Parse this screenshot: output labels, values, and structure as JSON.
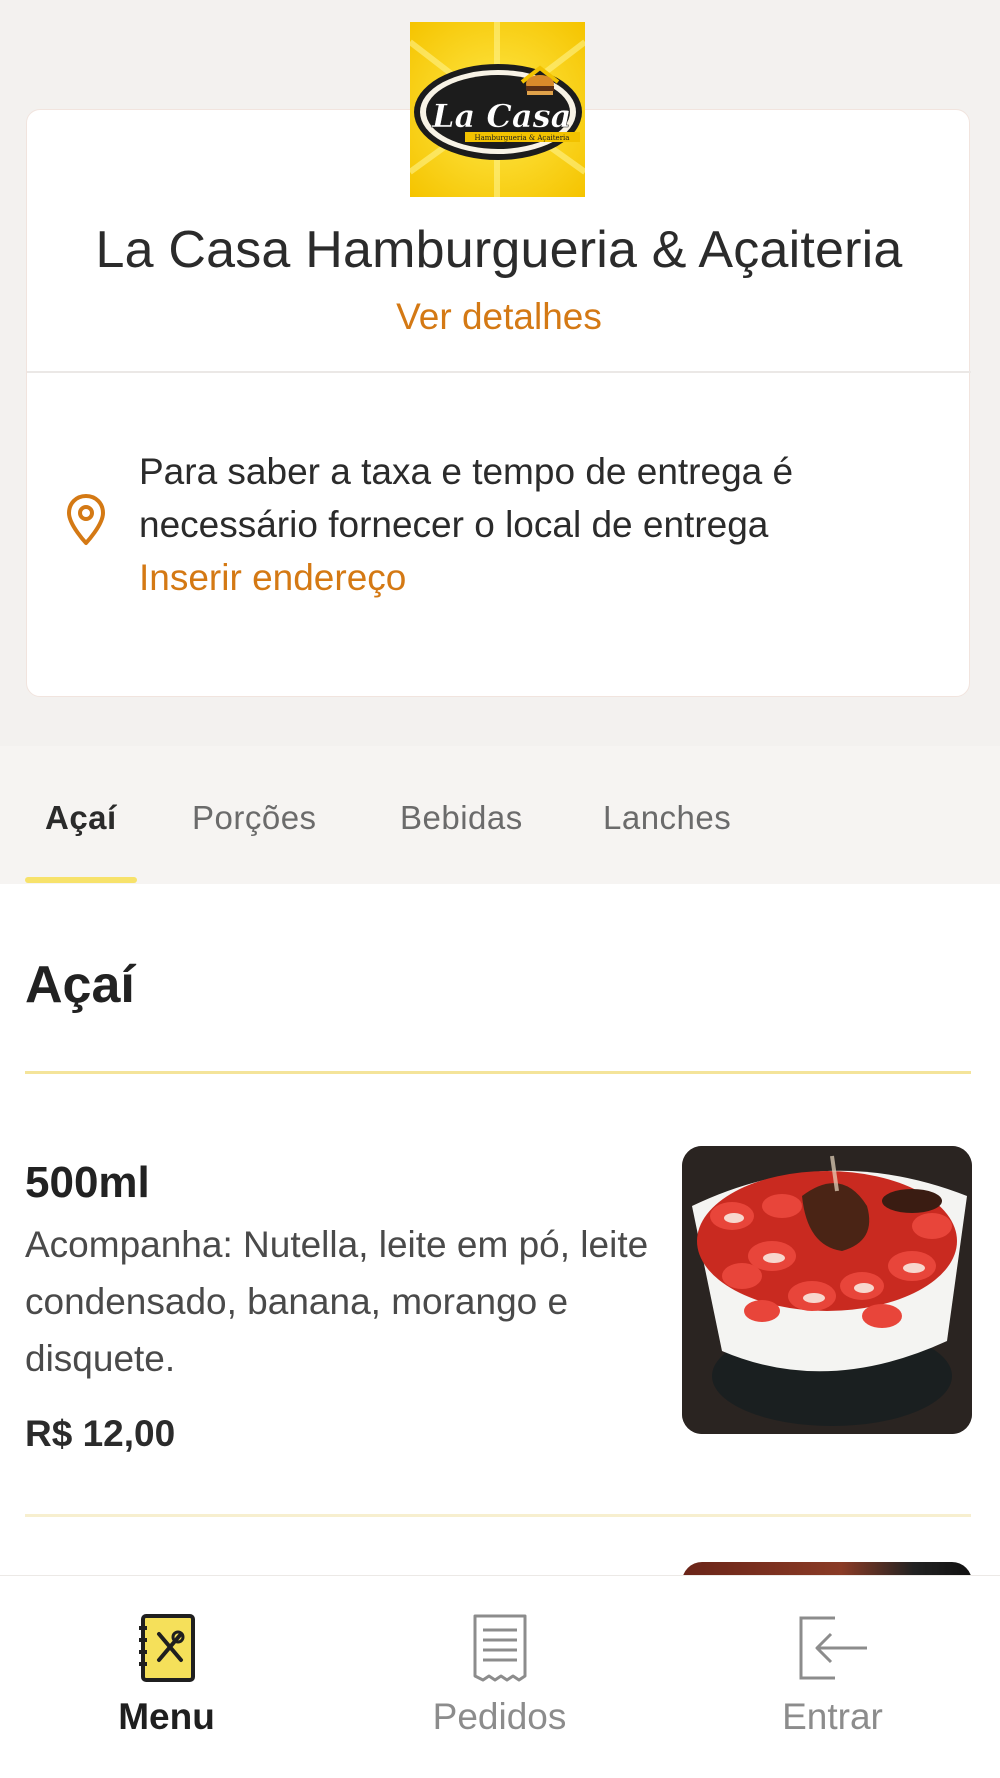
{
  "store": {
    "logo_text": "La Casa",
    "logo_subtext": "Hamburgueria & Açaiteria",
    "name": "La Casa Hamburgueria & Açaiteria",
    "details_link": "Ver detalhes"
  },
  "delivery": {
    "message": "Para saber a taxa e tempo de entrega é necessário fornecer o local de entrega",
    "address_link": "Inserir endereço",
    "icon": "location-pin-icon"
  },
  "tabs": [
    {
      "label": "Açaí",
      "active": true
    },
    {
      "label": "Porções",
      "active": false
    },
    {
      "label": "Bebidas",
      "active": false
    },
    {
      "label": "Lanches",
      "active": false
    }
  ],
  "section": {
    "title": "Açaí"
  },
  "products": [
    {
      "name": "500ml",
      "description": "Acompanha: Nutella, leite em pó, leite condensado, banana, morango e disquete.",
      "price": "R$ 12,00"
    }
  ],
  "bottom_nav": [
    {
      "label": "Menu",
      "icon": "menu-book-icon",
      "active": true
    },
    {
      "label": "Pedidos",
      "icon": "receipt-icon",
      "active": false
    },
    {
      "label": "Entrar",
      "icon": "login-icon",
      "active": false
    }
  ],
  "colors": {
    "accent": "#d47914",
    "highlight": "#f7e26b",
    "background": "#f3f1ef"
  }
}
